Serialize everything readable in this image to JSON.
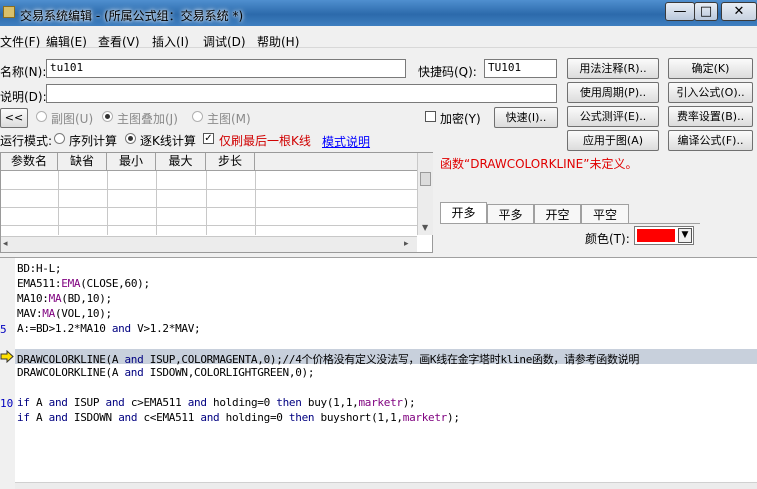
{
  "window": {
    "title": "交易系统编辑 - (所属公式组：交易系统 *)",
    "min": "—",
    "max": "□",
    "close": "✕"
  },
  "menu": [
    "文件(F)",
    "编辑(E)",
    "查看(V)",
    "插入(I)",
    "调试(D)",
    "帮助(H)"
  ],
  "form": {
    "name_label": "名称(N):",
    "name_value": "tu101",
    "hotkey_label": "快捷码(Q):",
    "hotkey_value": "TU101",
    "desc_label": "说明(D):",
    "desc_value": "",
    "nav_back": "<<",
    "sub_label": "副图(U)",
    "overlay_label": "主图叠加(J)",
    "main_label": "主图(M)",
    "encrypt_label": "加密(Y)",
    "fast_button": "快速(I)..",
    "run_mode_label": "运行模式:",
    "mode_series": "序列计算",
    "mode_bar": "逐K线计算",
    "refresh_last": "仅刷最后一根K线",
    "mode_help": "模式说明"
  },
  "buttons": {
    "usage_note": "用法注释(R)..",
    "ok": "确定(K)",
    "period": "使用周期(P)..",
    "import": "引入公式(O)..",
    "test": "公式测评(E)..",
    "fee": "费率设置(B)..",
    "apply": "应用于图(A)",
    "compile": "编译公式(F).."
  },
  "params": {
    "headers": [
      "参数名",
      "缺省",
      "最小",
      "最大",
      "步长"
    ]
  },
  "error": "函数“DRAWCOLORKLINE”未定义。",
  "tabs": [
    "开多",
    "平多",
    "开空",
    "平空"
  ],
  "color_label": "颜色(T):",
  "colors": {
    "swatch": "#ff0000",
    "highlight": "#c8d0dc",
    "title": "#2c6aab"
  },
  "editor": {
    "line_numbers": {
      "l5": "5",
      "l10": "10"
    },
    "lines": {
      "l1": "BD:H-L;",
      "l2a": "EMA511:",
      "l2b": "EMA",
      "l2c": "(CLOSE,60);",
      "l3a": "MA10:",
      "l3b": "MA",
      "l3c": "(BD,10);",
      "l4a": "MAV:",
      "l4b": "MA",
      "l4c": "(VOL,10);",
      "l5a": "A:=BD>1.2*MA10 ",
      "l5b": "and",
      "l5c": " V>1.2*MAV;",
      "l7a": "DRAWCOLORKLINE(A ",
      "l7b": "and",
      "l7c": " ISUP,COLORMAGENTA,0);//4个价格没有定义没法写，画K线在金字塔时kline函数，请参考函数说明",
      "l8a": "DRAWCOLORKLINE(A ",
      "l8b": "and",
      "l8c": " ISDOWN,COLORLIGHTGREEN,0);",
      "l10a": "if",
      "l10b": " A ",
      "l10c": "and",
      "l10d": " ISUP ",
      "l10e": "and",
      "l10f": " c>EMA511 ",
      "l10g": "and",
      "l10h": " holding=0 ",
      "l10i": "then",
      "l10j": " buy(1,1,",
      "l10k": "marketr",
      "l10l": ");",
      "l11a": "if",
      "l11b": " A ",
      "l11c": "and",
      "l11d": " ISDOWN ",
      "l11e": "and",
      "l11f": " c<EMA511 ",
      "l11g": "and",
      "l11h": " holding=0 ",
      "l11i": "then",
      "l11j": " buyshort(1,1,",
      "l11k": "marketr",
      "l11l": ");"
    }
  }
}
